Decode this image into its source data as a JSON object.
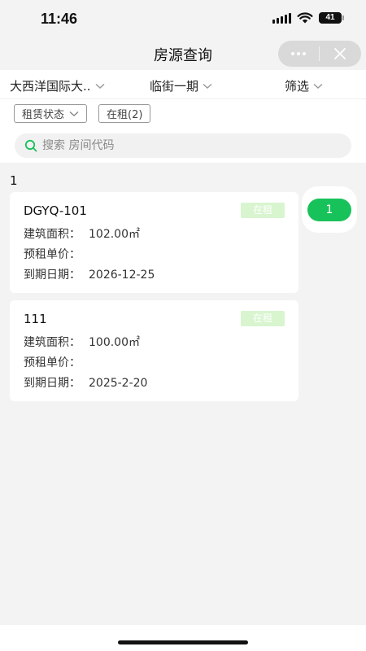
{
  "status_bar": {
    "time": "11:46",
    "battery": "41"
  },
  "nav": {
    "title": "房源查询"
  },
  "filters": [
    {
      "label": "大西洋国际大.."
    },
    {
      "label": "临街一期"
    },
    {
      "label": "筛选"
    }
  ],
  "tags": [
    {
      "label": "租赁状态"
    },
    {
      "label": "在租(2)"
    }
  ],
  "search": {
    "placeholder": "搜索 房间代码",
    "value": ""
  },
  "list": {
    "group_label": "1",
    "index_label": "1",
    "items": [
      {
        "code": "DGYQ-101",
        "status": "在租",
        "area_label": "建筑面积：",
        "area_value": "102.00㎡",
        "price_label": "预租单价：",
        "price_value": "",
        "due_label": "到期日期：",
        "due_value": "2026-12-25"
      },
      {
        "code": "111",
        "status": "在租",
        "area_label": "建筑面积：",
        "area_value": "100.00㎡",
        "price_label": "预租单价：",
        "price_value": "",
        "due_label": "到期日期：",
        "due_value": "2025-2-20"
      }
    ]
  },
  "colors": {
    "accent": "#18c25a",
    "badge_bg": "#d8f5cf",
    "page_bg": "#f3f3f3"
  },
  "icons": [
    "signal-icon",
    "wifi-icon",
    "battery-icon",
    "more-icon",
    "close-icon",
    "chevron-down-icon",
    "search-icon"
  ]
}
